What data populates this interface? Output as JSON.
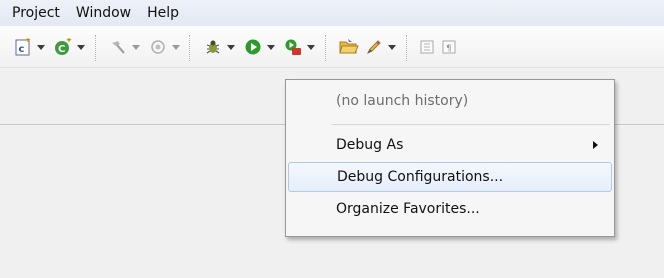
{
  "menubar": {
    "items": [
      "Project",
      "Window",
      "Help"
    ]
  },
  "toolbar": {
    "icons": [
      "new-c-project-icon",
      "new-class-icon",
      "build-hammer-icon",
      "build-target-icon",
      "debug-bug-icon",
      "run-icon",
      "external-tools-icon",
      "open-folder-icon",
      "edit-pen-icon",
      "toggle-block-icon",
      "show-whitespace-icon"
    ]
  },
  "debug_menu": {
    "history_placeholder": "(no launch history)",
    "items": [
      {
        "label": "Debug As",
        "has_submenu": true
      },
      {
        "label": "Debug Configurations...",
        "highlighted": true
      },
      {
        "label": "Organize Favorites..."
      }
    ]
  },
  "colors": {
    "menubar_bg": "#e3e8f3",
    "hover_border": "#aecaf0",
    "run_green": "#2e9a2e",
    "folder_yellow": "#e8b940"
  }
}
